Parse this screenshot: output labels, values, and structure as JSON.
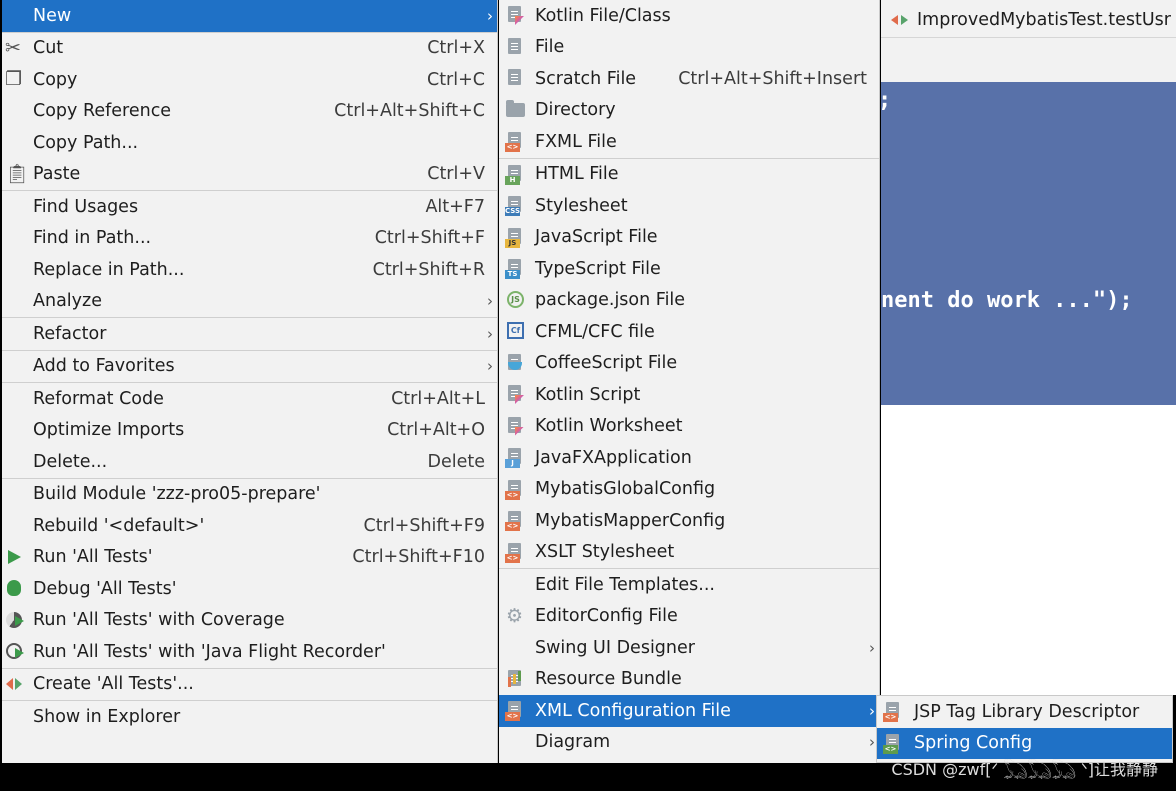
{
  "editor": {
    "tab_title": "ImprovedMybatisTest.testUsr",
    "code_fragment": ";",
    "code_line": "nent do work ...\");"
  },
  "main_menu": {
    "new": {
      "label": "New",
      "arrow": "›"
    },
    "cut": {
      "label": "Cut",
      "shortcut": "Ctrl+X"
    },
    "copy": {
      "label": "Copy",
      "shortcut": "Ctrl+C"
    },
    "copy_reference": {
      "label": "Copy Reference",
      "shortcut": "Ctrl+Alt+Shift+C"
    },
    "copy_path": {
      "label": "Copy Path..."
    },
    "paste": {
      "label": "Paste",
      "shortcut": "Ctrl+V"
    },
    "find_usages": {
      "label": "Find Usages",
      "shortcut": "Alt+F7"
    },
    "find_in_path": {
      "label": "Find in Path...",
      "shortcut": "Ctrl+Shift+F"
    },
    "replace_in_path": {
      "label": "Replace in Path...",
      "shortcut": "Ctrl+Shift+R"
    },
    "analyze": {
      "label": "Analyze",
      "arrow": "›"
    },
    "refactor": {
      "label": "Refactor",
      "arrow": "›"
    },
    "add_to_favorites": {
      "label": "Add to Favorites",
      "arrow": "›"
    },
    "reformat_code": {
      "label": "Reformat Code",
      "shortcut": "Ctrl+Alt+L"
    },
    "optimize_imports": {
      "label": "Optimize Imports",
      "shortcut": "Ctrl+Alt+O"
    },
    "delete": {
      "label": "Delete...",
      "shortcut": "Delete"
    },
    "build_module": {
      "label": "Build Module 'zzz-pro05-prepare'"
    },
    "rebuild": {
      "label": "Rebuild '<default>'",
      "shortcut": "Ctrl+Shift+F9"
    },
    "run_tests": {
      "label": "Run 'All Tests'",
      "shortcut": "Ctrl+Shift+F10"
    },
    "debug_tests": {
      "label": "Debug 'All Tests'"
    },
    "run_coverage": {
      "label": "Run 'All Tests' with Coverage"
    },
    "run_jfr": {
      "label": "Run 'All Tests' with 'Java Flight Recorder'"
    },
    "create_tests": {
      "label": "Create 'All Tests'..."
    },
    "show_in_explorer": {
      "label": "Show in Explorer"
    }
  },
  "new_submenu": {
    "kotlin_file_class": {
      "label": "Kotlin File/Class"
    },
    "file": {
      "label": "File"
    },
    "scratch_file": {
      "label": "Scratch File",
      "shortcut": "Ctrl+Alt+Shift+Insert"
    },
    "directory": {
      "label": "Directory"
    },
    "fxml_file": {
      "label": "FXML File"
    },
    "html_file": {
      "label": "HTML File"
    },
    "stylesheet": {
      "label": "Stylesheet"
    },
    "javascript_file": {
      "label": "JavaScript File"
    },
    "typescript_file": {
      "label": "TypeScript File"
    },
    "package_json": {
      "label": "package.json File"
    },
    "cfml_file": {
      "label": "CFML/CFC file"
    },
    "coffeescript_file": {
      "label": "CoffeeScript File"
    },
    "kotlin_script": {
      "label": "Kotlin Script"
    },
    "kotlin_worksheet": {
      "label": "Kotlin Worksheet"
    },
    "javafx_application": {
      "label": "JavaFXApplication"
    },
    "mybatis_global_config": {
      "label": "MybatisGlobalConfig"
    },
    "mybatis_mapper_config": {
      "label": "MybatisMapperConfig"
    },
    "xslt_stylesheet": {
      "label": "XSLT Stylesheet"
    },
    "edit_file_templates": {
      "label": "Edit File Templates..."
    },
    "editorconfig_file": {
      "label": "EditorConfig File"
    },
    "swing_ui_designer": {
      "label": "Swing UI Designer",
      "arrow": "›"
    },
    "resource_bundle": {
      "label": "Resource Bundle"
    },
    "xml_configuration_file": {
      "label": "XML Configuration File",
      "arrow": "›"
    },
    "diagram": {
      "label": "Diagram",
      "arrow": "›"
    }
  },
  "xml_submenu": {
    "jsp_tag_library": {
      "label": "JSP Tag Library Descriptor"
    },
    "spring_config": {
      "label": "Spring Config"
    }
  },
  "icon_badges": {
    "xml": "<>",
    "html": "H",
    "css": "CSS",
    "js": "JS",
    "ts": "TS",
    "java": "J",
    "node": "JS",
    "cfml": "Cf"
  },
  "colors": {
    "menu_bg": "#f2f2f2",
    "highlight": "#1f71c6",
    "editor_code_bg": "#5871a9"
  },
  "watermark": "CSDN @zwf[ᐟ 𓆏𓆏𓆏 ᐠ]让我静静"
}
